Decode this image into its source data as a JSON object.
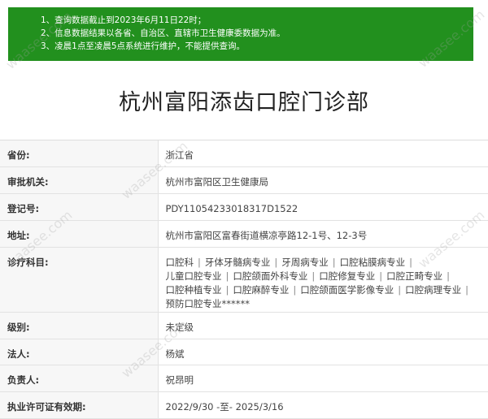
{
  "notice": {
    "lines": [
      "1、查询数据截止到2023年6月11日22时；",
      "2、信息数据结果以各省、自治区、直辖市卫生健康委数据为准。",
      "3、凌晨1点至凌晨5点系统进行维护，不能提供查询。"
    ]
  },
  "title": "杭州富阳添齿口腔门诊部",
  "rows": [
    {
      "label": "省份:",
      "value": "浙江省"
    },
    {
      "label": "审批机关:",
      "value": "杭州市富阳区卫生健康局"
    },
    {
      "label": "登记号:",
      "value": "PDY11054233018317D1522"
    },
    {
      "label": "地址:",
      "value": "杭州市富阳区富春街道横凉亭路12-1号、12-3号"
    },
    {
      "label": "诊疗科目:",
      "value": ""
    },
    {
      "label": "级别:",
      "value": "未定级"
    },
    {
      "label": "法人:",
      "value": "杨斌"
    },
    {
      "label": "负责人:",
      "value": "祝昂明"
    },
    {
      "label": "执业许可证有效期:",
      "value": "2022/9/30 -至- 2025/3/16"
    }
  ],
  "subjects": [
    "口腔科",
    "牙体牙髓病专业",
    "牙周病专业",
    "口腔粘膜病专业",
    "儿童口腔专业",
    "口腔颌面外科专业",
    "口腔修复专业",
    "口腔正畸专业",
    "口腔种植专业",
    "口腔麻醉专业",
    "口腔颌面医学影像专业",
    "口腔病理专业",
    "预防口腔专业******"
  ],
  "watermark": "waasee.com"
}
